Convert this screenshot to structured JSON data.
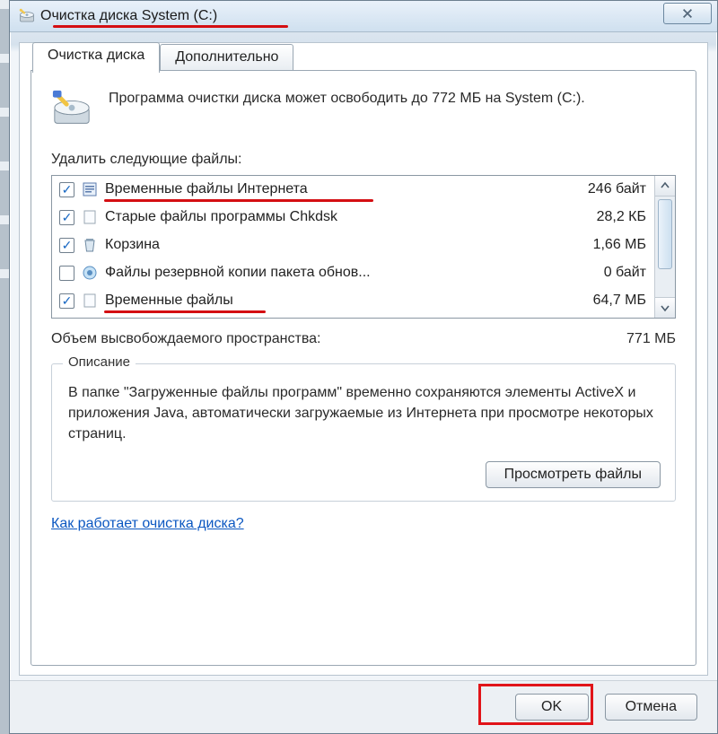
{
  "window": {
    "title": "Очистка диска System (C:)"
  },
  "tabs": {
    "active": "Очистка диска",
    "other": "Дополнительно"
  },
  "header": {
    "text": "Программа очистки диска может освободить до 772 МБ на System (C:)."
  },
  "list_label": "Удалить следующие файлы:",
  "items": [
    {
      "checked": true,
      "label": "Временные файлы Интернета",
      "size": "246 байт",
      "underline": true
    },
    {
      "checked": true,
      "label": "Старые файлы программы Chkdsk",
      "size": "28,2 КБ",
      "underline": false
    },
    {
      "checked": true,
      "label": "Корзина",
      "size": "1,66 МБ",
      "underline": false
    },
    {
      "checked": false,
      "label": "Файлы резервной копии пакета обнов...",
      "size": "0 байт",
      "underline": false
    },
    {
      "checked": true,
      "label": "Временные файлы",
      "size": "64,7 МБ",
      "underline": true
    }
  ],
  "freed": {
    "label": "Объем высвобождаемого пространства:",
    "value": "771 МБ"
  },
  "description": {
    "legend": "Описание",
    "text": "В папке \"Загруженные файлы программ\" временно сохраняются элементы ActiveX и приложения Java, автоматически загружаемые из Интернета при просмотре некоторых страниц.",
    "view_button": "Просмотреть файлы"
  },
  "help_link": "Как работает очистка диска?",
  "buttons": {
    "ok": "OK",
    "cancel": "Отмена"
  },
  "annotation_color": "#d40e12"
}
